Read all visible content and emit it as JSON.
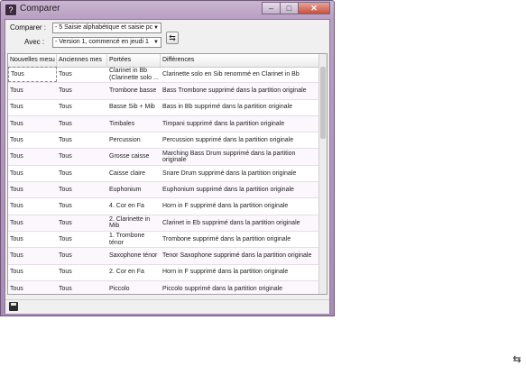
{
  "window": {
    "title": "Comparer",
    "buttons": {
      "minimize": "–",
      "maximize": "□",
      "close": "✕"
    }
  },
  "compare": {
    "label": "Comparer :",
    "value": "- 5 Saisie alphabétique et saisie pc",
    "with_label": "Avec :",
    "with_value": "- Version 1, commencé en jeudi 1"
  },
  "table": {
    "columns": [
      "Nouvelles mesu",
      "Anciennes mes",
      "Portées",
      "Différences"
    ],
    "rows": [
      [
        "Tous",
        "Tous",
        "Clarinet in Bb (Clarinette solo ...",
        "Clarinette solo en Sib renommé en Clarinet in Bb"
      ],
      [
        "Tous",
        "Tous",
        "Trombone basse",
        "Bass Trombone supprimé dans la partition originale"
      ],
      [
        "Tous",
        "Tous",
        "Basse Sib + Mib",
        "Bass in Bb supprimé dans la partition originale"
      ],
      [
        "Tous",
        "Tous",
        "Timbales",
        "Timpani supprimé dans la partition originale"
      ],
      [
        "Tous",
        "Tous",
        "Percussion",
        "Percussion supprimé dans la partition originale"
      ],
      [
        "Tous",
        "Tous",
        "Grosse caisse",
        "Marching Bass Drum supprimé dans la partition originale"
      ],
      [
        "Tous",
        "Tous",
        "Caisse claire",
        "Snare Drum supprimé dans la partition originale"
      ],
      [
        "Tous",
        "Tous",
        "Euphonium",
        "Euphonium supprimé dans la partition originale"
      ],
      [
        "Tous",
        "Tous",
        "4. Cor en Fa",
        "Horn in F supprimé dans la partition originale"
      ],
      [
        "Tous",
        "Tous",
        "2. Clarinette in Mib",
        "Clarinet in Eb supprimé dans la partition originale"
      ],
      [
        "Tous",
        "Tous",
        "1. Trombone ténor",
        "Trombone supprimé dans la partition originale"
      ],
      [
        "Tous",
        "Tous",
        "Saxophone ténor",
        "Tenor Saxophone supprimé dans la partition originale"
      ],
      [
        "Tous",
        "Tous",
        "2. Cor en Fa",
        "Horn in F supprimé dans la partition originale"
      ],
      [
        "Tous",
        "Tous",
        "Piccolo",
        "Piccolo supprimé dans la partition originale"
      ]
    ]
  },
  "icons": {
    "swap": "⇆",
    "save": "save-icon",
    "app": "?"
  }
}
